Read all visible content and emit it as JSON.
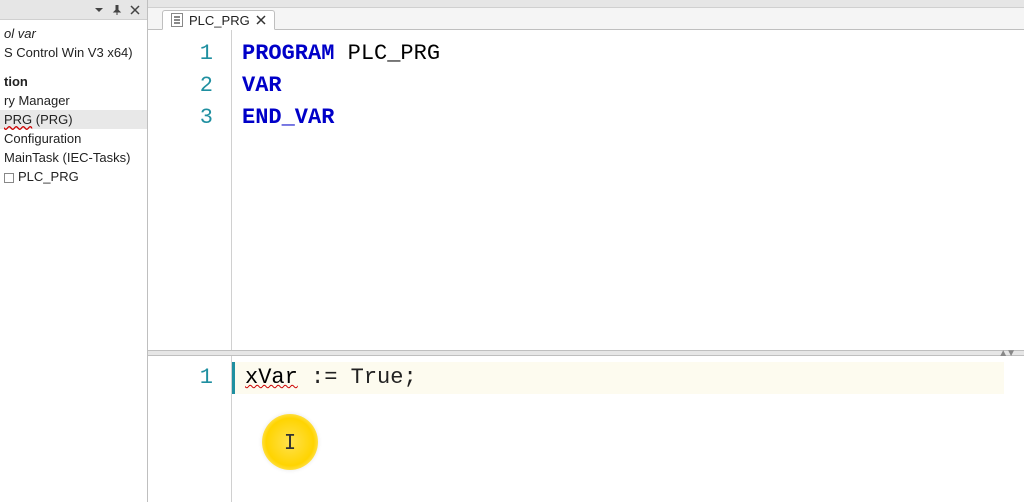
{
  "sidebar": {
    "items": [
      {
        "label": "ol var",
        "italic": true
      },
      {
        "label": "S Control Win V3 x64)"
      }
    ],
    "section_label": "tion",
    "tree": [
      {
        "label": "ry Manager"
      },
      {
        "label": "PRG (PRG)",
        "selected": true,
        "wavy_part": "PRG"
      },
      {
        "label": "Configuration"
      },
      {
        "label": "MainTask (IEC-Tasks)"
      },
      {
        "label": "PLC_PRG",
        "bullet": true
      }
    ]
  },
  "tabs": [
    {
      "label": "PLC_PRG"
    }
  ],
  "declaration": {
    "lines": [
      {
        "num": "1",
        "tokens": [
          {
            "t": "PROGRAM",
            "kw": true
          },
          {
            "t": " "
          },
          {
            "t": "PLC_PRG"
          }
        ]
      },
      {
        "num": "2",
        "tokens": [
          {
            "t": "VAR",
            "kw": true
          }
        ]
      },
      {
        "num": "3",
        "tokens": [
          {
            "t": "END_VAR",
            "kw": true
          }
        ]
      }
    ]
  },
  "implementation": {
    "lines": [
      {
        "num": "1",
        "tokens": [
          {
            "t": "xVar",
            "wavy": true
          },
          {
            "t": " := "
          },
          {
            "t": "True"
          },
          {
            "t": ";"
          }
        ],
        "current": true
      }
    ]
  },
  "cursor_glyph": "I"
}
